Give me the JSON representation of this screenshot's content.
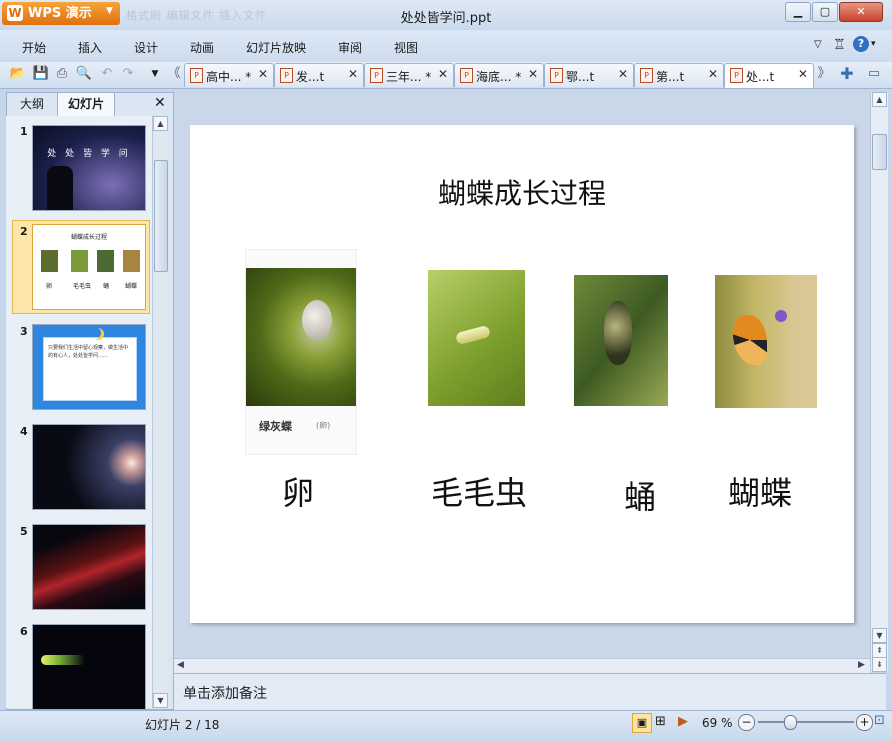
{
  "app": {
    "name": "WPS 演示",
    "logo_char": "W",
    "document_title": "处处皆学问.ppt",
    "qat_ghost": "格式刷 编辑文件 插入文件"
  },
  "window_controls": {
    "minimize": "▁",
    "restore": "▢",
    "close": "✕"
  },
  "menu": [
    "开始",
    "插入",
    "设计",
    "动画",
    "幻灯片放映",
    "审阅",
    "视图"
  ],
  "toolbar_icons": [
    "open-icon",
    "save-icon",
    "print-icon",
    "print-preview-icon",
    "undo-icon",
    "redo-icon",
    "dropdown-icon"
  ],
  "doc_tabs": [
    {
      "label": "高中... *",
      "active": false
    },
    {
      "label": "发...t",
      "active": false
    },
    {
      "label": "三年... *",
      "active": false
    },
    {
      "label": "海底... *",
      "active": false
    },
    {
      "label": "鄂...t",
      "active": false
    },
    {
      "label": "第...t",
      "active": false
    },
    {
      "label": "处...t",
      "active": true
    }
  ],
  "left_pane": {
    "tab_outline": "大纲",
    "tab_slides": "幻灯片",
    "close": "✕",
    "slides": [
      {
        "num": "1",
        "thumb_text": "处 处 皆 学 问"
      },
      {
        "num": "2",
        "thumb_title": "蝴蝶成长过程",
        "thumb_captions": [
          "卵",
          "毛毛虫",
          "蛹",
          "蝴蝶"
        ]
      },
      {
        "num": "3",
        "thumb_text": "只要我们生活中留心观察，做生活中的有心人，处处皆学问……"
      },
      {
        "num": "4"
      },
      {
        "num": "5"
      },
      {
        "num": "6"
      }
    ]
  },
  "slide": {
    "title": "蝴蝶成长过程",
    "image_caption_small": "绿灰蝶",
    "image_caption_small2": "(卵)",
    "captions": [
      "卵",
      "毛毛虫",
      "蛹",
      "蝴蝶"
    ]
  },
  "notes_placeholder": "单击添加备注",
  "status": {
    "slide_indicator": "幻灯片 2 / 18",
    "zoom": "69 %"
  },
  "colors": {
    "accent_orange": "#e0700f",
    "selected_thumb": "#fde7a8"
  }
}
